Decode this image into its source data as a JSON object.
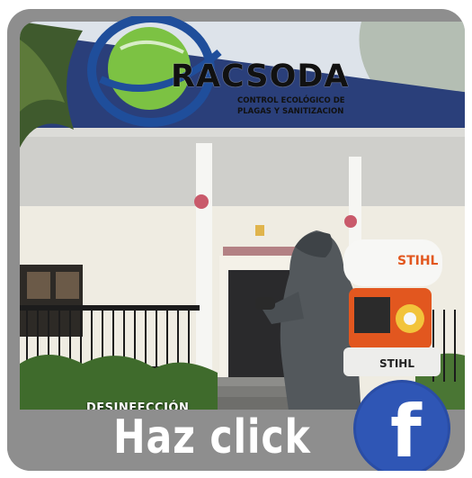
{
  "brand": {
    "name": "RACSODA",
    "tagline": "CONTROL ECOLÓGICO DE PLAGAS Y SANITIZACION"
  },
  "photo": {
    "sprayer_brand": "STIHL",
    "caption": "DESINFECCIÓN"
  },
  "cta": {
    "label": "Haz click",
    "facebook_glyph": "f"
  },
  "colors": {
    "frame": "#8e8e8e",
    "facebook": "#2f56b5",
    "logo_green": "#7cc243",
    "logo_blue": "#1f4e9b",
    "sprayer_orange": "#e2571f"
  },
  "icons": [
    "racsoda-globe-logo",
    "facebook-icon"
  ]
}
